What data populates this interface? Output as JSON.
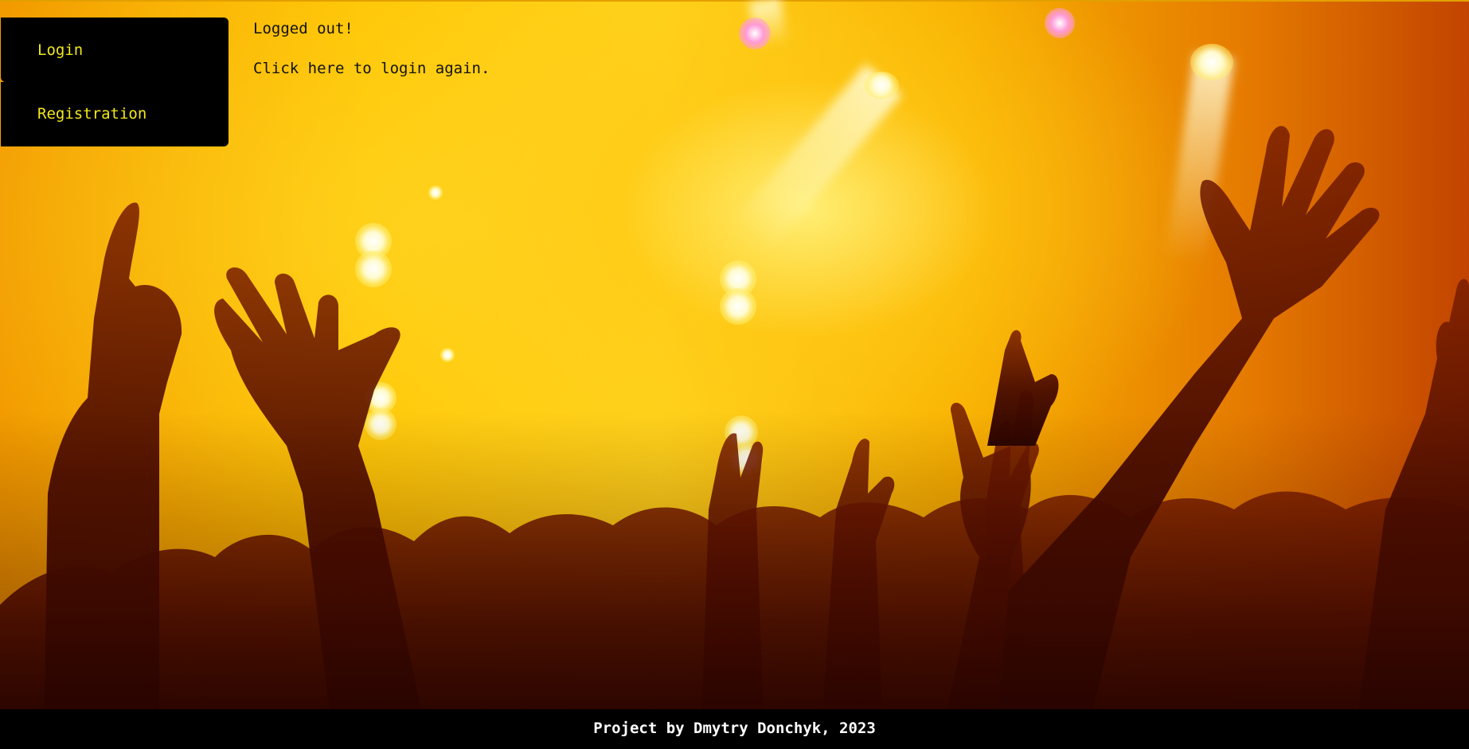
{
  "nav": {
    "items": [
      {
        "label": "Login"
      },
      {
        "label": "Registration"
      }
    ]
  },
  "message": {
    "status": "Logged out!",
    "link_text": "Click here to login again."
  },
  "footer": {
    "text": "Project by Dmytry Donchyk, 2023"
  },
  "background": {
    "description_icon": "concert-crowd-image",
    "accent_color": "#f2e81a"
  }
}
